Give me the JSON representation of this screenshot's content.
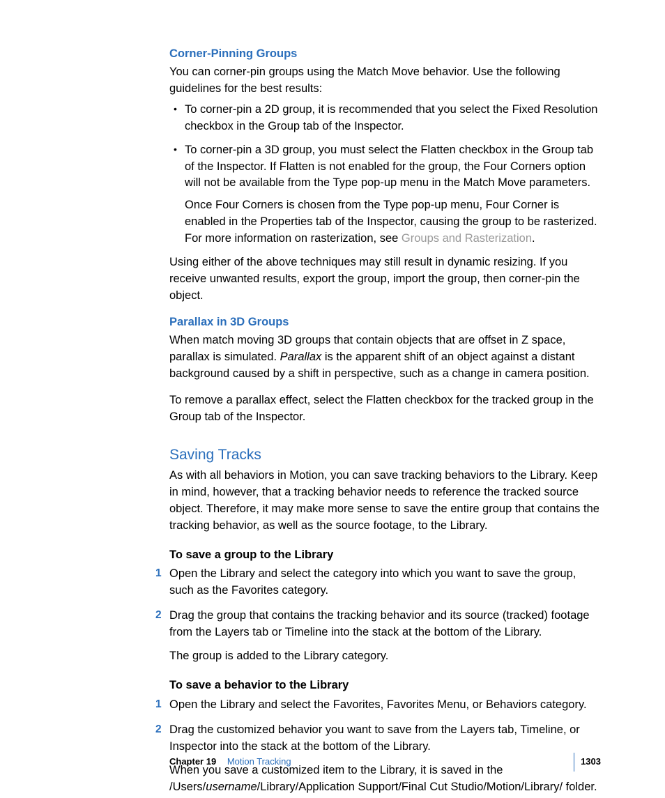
{
  "sections": {
    "cornerPinning": {
      "title": "Corner-Pinning Groups",
      "intro": "You can corner-pin groups using the Match Move behavior. Use the following guidelines for the best results:",
      "bullet1": "To corner-pin a 2D group, it is recommended that you select the Fixed Resolution checkbox in the Group tab of the Inspector.",
      "bullet2a": "To corner-pin a 3D group, you must select the Flatten checkbox in the Group tab of the Inspector. If Flatten is not enabled for the group, the Four Corners option will not be available from the Type pop-up menu in the Match Move parameters.",
      "bullet2b_pre": "Once Four Corners is chosen from the Type pop-up menu, Four Corner is enabled in the Properties tab of the Inspector, causing the group to be rasterized. For more information on rasterization, see ",
      "bullet2b_link": "Groups and Rasterization",
      "bullet2b_post": ".",
      "after": "Using either of the above techniques may still result in dynamic resizing. If you receive unwanted results, export the group, import the group, then corner-pin the object."
    },
    "parallax": {
      "title": "Parallax in 3D Groups",
      "p1_pre": "When match moving 3D groups that contain objects that are offset in Z space, parallax is simulated. ",
      "p1_italic": "Parallax",
      "p1_post": " is the apparent shift of an object against a distant background caused by a shift in perspective, such as a change in camera position.",
      "p2": "To remove a parallax effect, select the Flatten checkbox for the tracked group in the Group tab of the Inspector."
    },
    "saving": {
      "title": "Saving Tracks",
      "intro": "As with all behaviors in Motion, you can save tracking behaviors to the Library. Keep in mind, however, that a tracking behavior needs to reference the tracked source object. Therefore, it may make more sense to save the entire group that contains the tracking behavior, as well as the source footage, to the Library.",
      "proc1_title": "To save a group to the Library",
      "proc1_step1": "Open the Library and select the category into which you want to save the group, such as the Favorites category.",
      "proc1_step2": "Drag the group that contains the tracking behavior and its source (tracked) footage from the Layers tab or Timeline into the stack at the bottom of the Library.",
      "proc1_result": "The group is added to the Library category.",
      "proc2_title": "To save a behavior to the Library",
      "proc2_step1": "Open the Library and select the Favorites, Favorites Menu, or Behaviors category.",
      "proc2_step2": "Drag the customized behavior you want to save from the Layers tab, Timeline, or Inspector into the stack at the bottom of the Library.",
      "proc2_result_pre": "When you save a customized item to the Library, it is saved in the /Users/",
      "proc2_result_italic": "username",
      "proc2_result_post": "/Library/Application Support/Final Cut Studio/Motion/Library/ folder."
    }
  },
  "footer": {
    "chapterLabel": "Chapter 19",
    "chapterTitle": "Motion Tracking",
    "page": "1303"
  },
  "nums": {
    "one": "1",
    "two": "2"
  }
}
